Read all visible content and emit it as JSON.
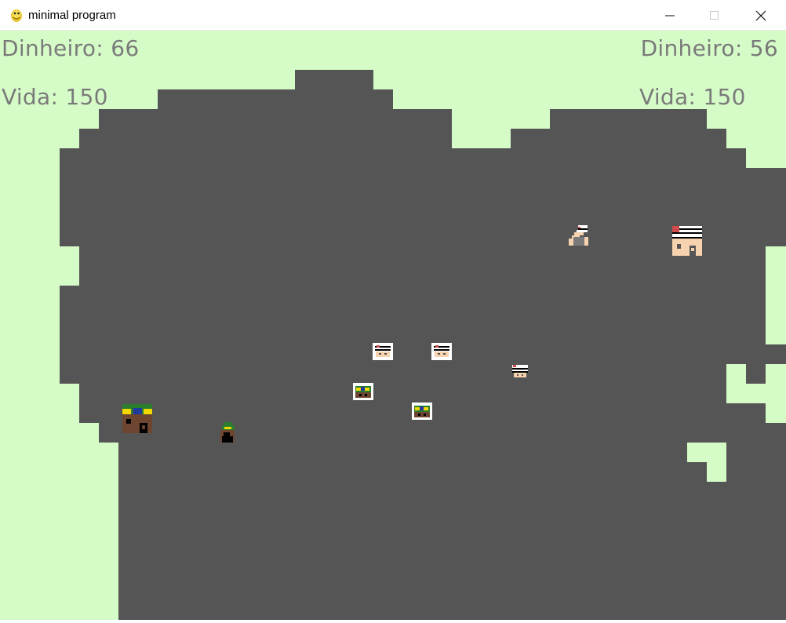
{
  "window": {
    "title": "minimal program",
    "controls": {
      "minimize": "minimize-icon",
      "maximize": "maximize-icon",
      "close": "close-icon"
    }
  },
  "hud": {
    "left": {
      "money": "Dinheiro: 66",
      "life": "Vida: 150"
    },
    "right": {
      "money": "Dinheiro: 56",
      "life": "Vida: 150"
    }
  },
  "colors": {
    "grass": "#d5fcc7",
    "map": "#555555",
    "hud_text": "#7a7a7a",
    "brazil_green": "#2b7d2f",
    "brazil_yellow": "#f0d800",
    "brazil_blue": "#1f3a9c",
    "base_brown": "#6e4530",
    "sp_white": "#ffffff",
    "sp_skin": "#f6d2ae",
    "sp_red": "#cf4b4b"
  },
  "units": {
    "left_team": "brazil-flag-soldiers",
    "right_team": "sao-paulo-flag-soldiers"
  }
}
